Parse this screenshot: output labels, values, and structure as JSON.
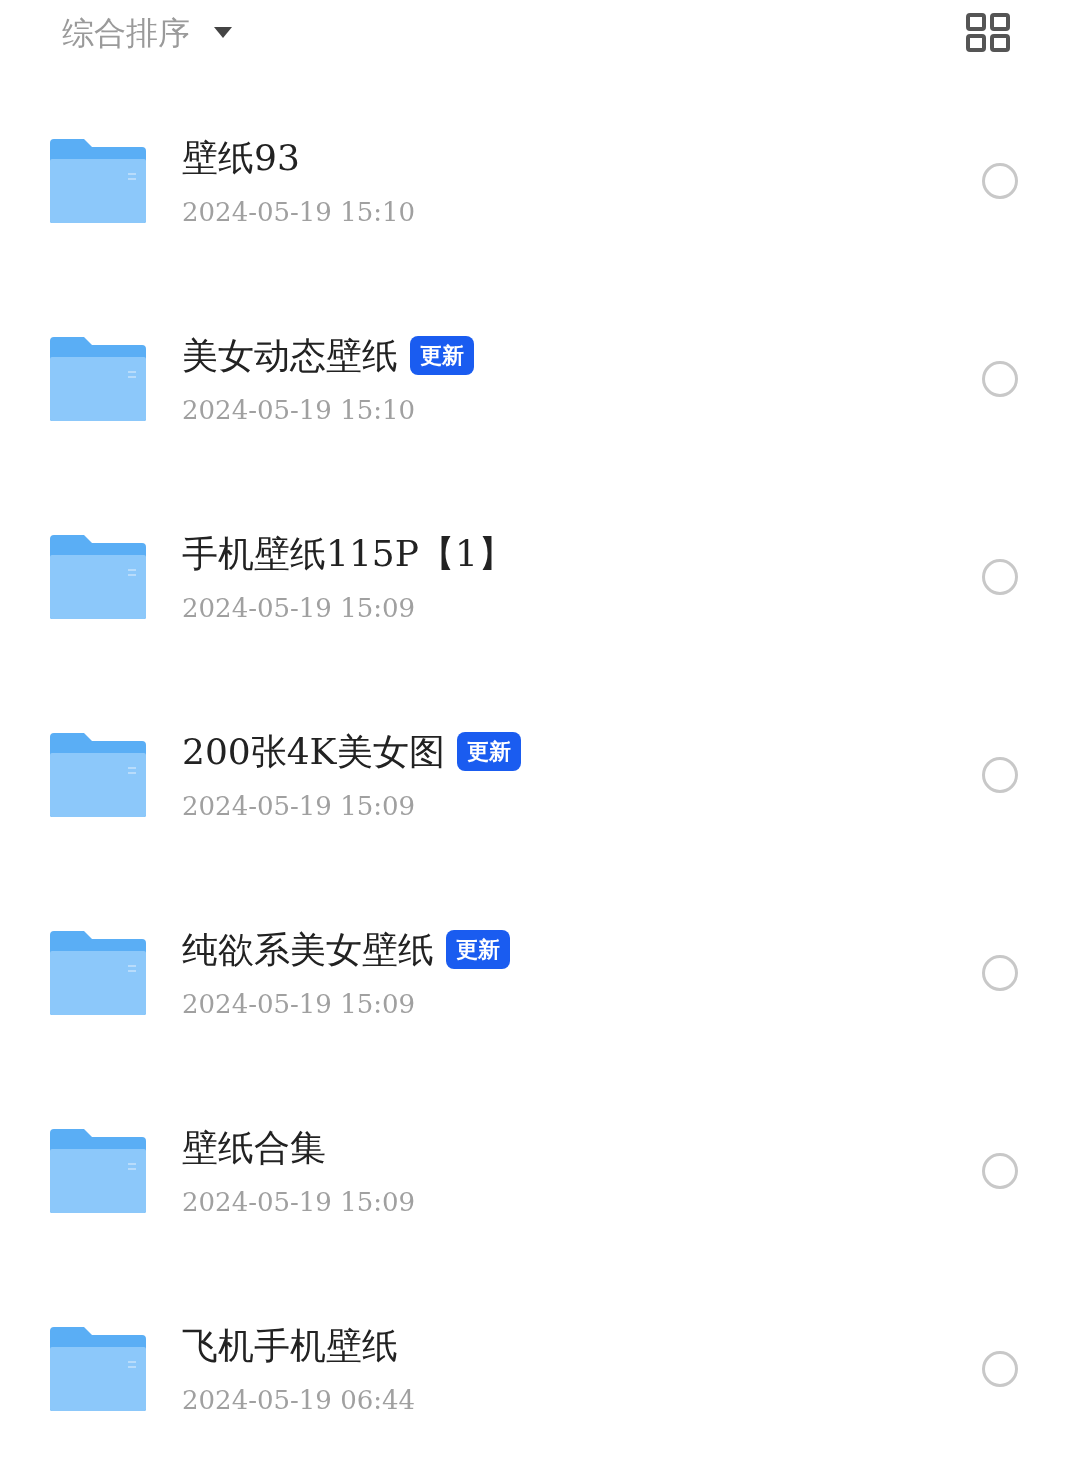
{
  "toolbar": {
    "sort_label": "综合排序"
  },
  "files": [
    {
      "name": "壁纸93",
      "date": "2024-05-19 15:10",
      "selected": false
    },
    {
      "name": "美女动态壁纸",
      "date": "2024-05-19 15:10",
      "badge": "更新",
      "selected": false
    },
    {
      "name": "手机壁纸115P【1】",
      "date": "2024-05-19 15:09",
      "selected": false
    },
    {
      "name": "200张4K美女图",
      "date": "2024-05-19 15:09",
      "badge": "更新",
      "selected": false
    },
    {
      "name": "纯欲系美女壁纸",
      "date": "2024-05-19 15:09",
      "badge": "更新",
      "selected": false
    },
    {
      "name": "壁纸合集",
      "date": "2024-05-19 15:09",
      "selected": false
    },
    {
      "name": "飞机手机壁纸",
      "date": "2024-05-19 06:44",
      "selected": false
    }
  ]
}
